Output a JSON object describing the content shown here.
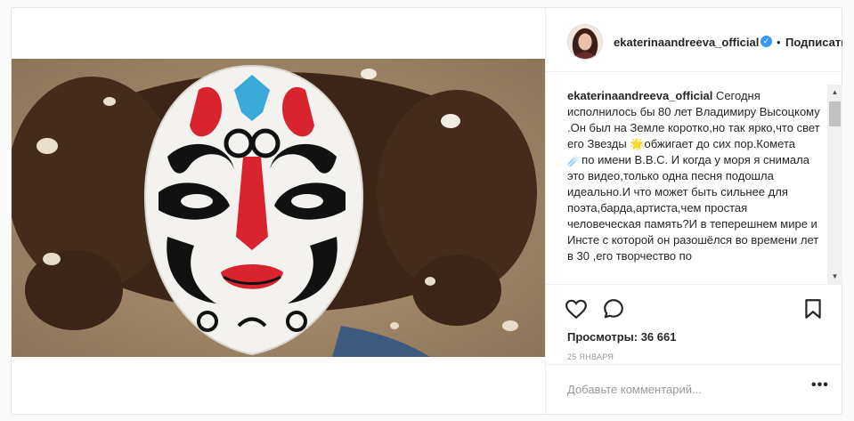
{
  "header": {
    "username": "ekaterinaandreeva_official",
    "separator": "•",
    "follow_label": "Подписаться"
  },
  "caption": {
    "username": "ekaterinaandreeva_official",
    "text": " Сегодня исполнилось бы 80 лет Владимиру Высоцкому .Он был на Земле коротко,но так ярко,что свет его Звезды 🌟обжигает до сих пор.Комета ☄️по имени В.В.С. И когда у моря я снимала это видео,только одна песня подошла идеально.И что может быть сильнее для поэта,барда,артиста,чем простая человеческая память?И в теперешнем мире и Инсте с которой он разошёлся во времени лет в 30 ,его творчество по"
  },
  "stats": {
    "views_label": "Просмотры: 36 661",
    "date": "25 ЯНВАРЯ"
  },
  "comment": {
    "placeholder": "Добавьте комментарий...",
    "more_label": "•••"
  },
  "icons": {
    "verified": "verified-badge-icon",
    "like": "heart-icon",
    "comment": "speech-bubble-icon",
    "save": "bookmark-icon",
    "scroll_up": "triangle-up-icon",
    "scroll_down": "triangle-down-icon"
  },
  "colors": {
    "accent": "#3897f0",
    "text": "#262626",
    "muted": "#999999",
    "border": "#efefef"
  }
}
